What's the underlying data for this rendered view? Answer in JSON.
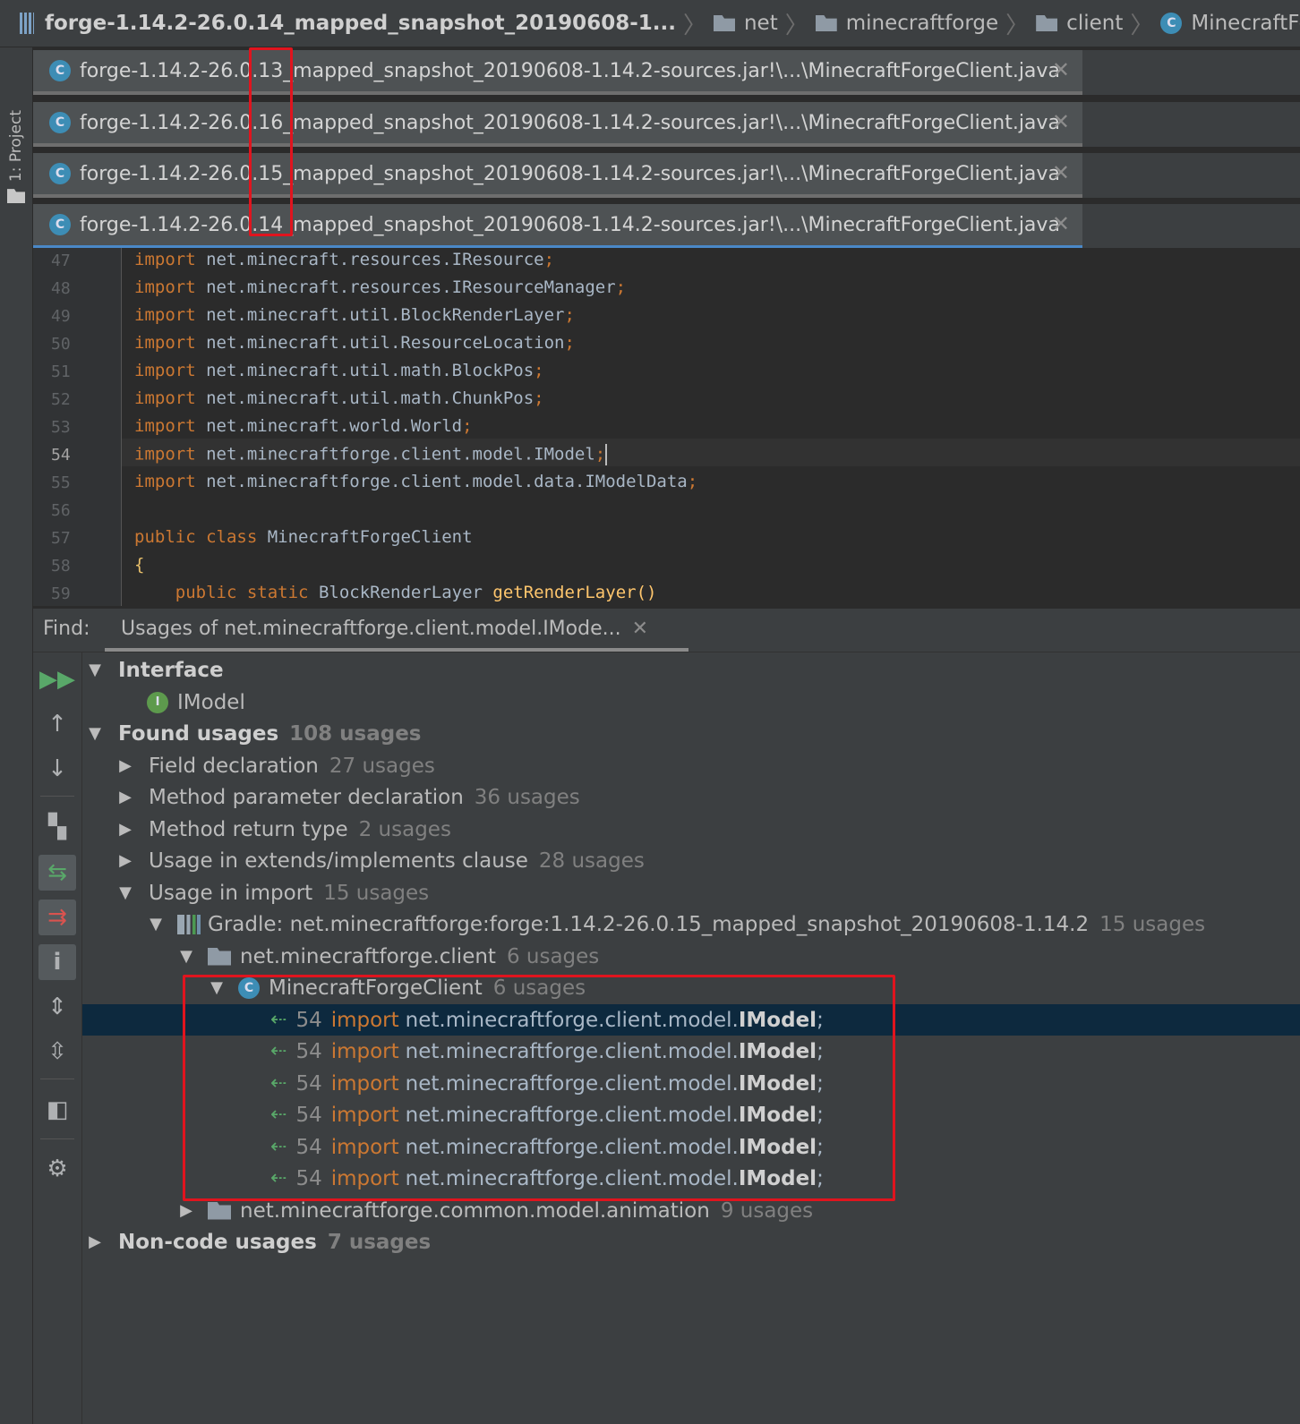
{
  "navbar": {
    "crumbs": [
      {
        "label": "forge-1.14.2-26.0.14_mapped_snapshot_20190608-1...",
        "icon": "jar-icon"
      },
      {
        "label": "net",
        "icon": "folder-icon"
      },
      {
        "label": "minecraftforge",
        "icon": "folder-icon"
      },
      {
        "label": "client",
        "icon": "folder-icon"
      },
      {
        "label": "MinecraftForgeClient",
        "icon": "class-icon"
      }
    ]
  },
  "left_strip": {
    "project_tab": "1: Project"
  },
  "editor_tabs": [
    {
      "title": "forge-1.14.2-26.0.13_mapped_snapshot_20190608-1.14.2-sources.jar!\\...\\MinecraftForgeClient.java",
      "active": false
    },
    {
      "title": "forge-1.14.2-26.0.16_mapped_snapshot_20190608-1.14.2-sources.jar!\\...\\MinecraftForgeClient.java",
      "active": false
    },
    {
      "title": "forge-1.14.2-26.0.15_mapped_snapshot_20190608-1.14.2-sources.jar!\\...\\MinecraftForgeClient.java",
      "active": false
    },
    {
      "title": "forge-1.14.2-26.0.14_mapped_snapshot_20190608-1.14.2-sources.jar!\\...\\MinecraftForgeClient.java",
      "active": true
    }
  ],
  "code": {
    "current_line": "54",
    "lines": [
      {
        "num": "47",
        "kw": "import",
        "rest": "net.minecraft.resources.IResource",
        "semi": ";"
      },
      {
        "num": "48",
        "kw": "import",
        "rest": "net.minecraft.resources.IResourceManager",
        "semi": ";"
      },
      {
        "num": "49",
        "kw": "import",
        "rest": "net.minecraft.util.BlockRenderLayer",
        "semi": ";"
      },
      {
        "num": "50",
        "kw": "import",
        "rest": "net.minecraft.util.ResourceLocation",
        "semi": ";"
      },
      {
        "num": "51",
        "kw": "import",
        "rest": "net.minecraft.util.math.BlockPos",
        "semi": ";"
      },
      {
        "num": "52",
        "kw": "import",
        "rest": "net.minecraft.util.math.ChunkPos",
        "semi": ";"
      },
      {
        "num": "53",
        "kw": "import",
        "rest": "net.minecraft.world.World",
        "semi": ";"
      },
      {
        "num": "54",
        "kw": "import",
        "rest": "net.minecraftforge.client.model.IModel",
        "semi": ";"
      },
      {
        "num": "55",
        "kw": "import",
        "rest": "net.minecraftforge.client.model.data.IModelData",
        "semi": ";"
      },
      {
        "num": "56",
        "kw": "",
        "rest": "",
        "semi": ""
      },
      {
        "num": "57",
        "kw": "public class",
        "rest": "MinecraftForgeClient",
        "semi": ""
      },
      {
        "num": "58",
        "kw": "",
        "rest": "{",
        "semi": ""
      },
      {
        "num": "59",
        "kw": "public static",
        "rest": "BlockRenderLayer",
        "fn": "getRenderLayer()",
        "semi": ""
      }
    ]
  },
  "find": {
    "label": "Find:",
    "tab_title": "Usages of net.minecraftforge.client.model.IMode...",
    "toolbar_icons": [
      "rerun-icon",
      "previous-occurrence-icon",
      "next-occurrence-icon",
      "group-by-icon",
      "show-read-access-icon",
      "show-write-access-icon",
      "info-icon",
      "expand-all-icon",
      "collapse-all-icon",
      "preview-icon",
      "settings-icon"
    ],
    "tree": {
      "interface_label": "Interface",
      "interface_name": "IModel",
      "found_label": "Found usages",
      "found_count": "108 usages",
      "groups": [
        {
          "label": "Field declaration",
          "count": "27 usages"
        },
        {
          "label": "Method parameter declaration",
          "count": "36 usages"
        },
        {
          "label": "Method return type",
          "count": "2 usages"
        },
        {
          "label": "Usage in extends/implements clause",
          "count": "28 usages"
        },
        {
          "label": "Usage in import",
          "count": "15 usages"
        }
      ],
      "gradle_label": "Gradle: net.minecraftforge:forge:1.14.2-26.0.15_mapped_snapshot_20190608-1.14.2",
      "gradle_count": "15 usages",
      "pkg_client_label": "net.minecraftforge.client",
      "pkg_client_count": "6 usages",
      "class_label": "MinecraftForgeClient",
      "class_count": "6 usages",
      "usage_line": {
        "num": "54",
        "kw": "import",
        "path": "net.minecraftforge.client.model.",
        "hit": "IModel",
        "semi": ";"
      },
      "pkg_anim_label": "net.minecraftforge.common.model.animation",
      "pkg_anim_count": "9 usages",
      "noncode_label": "Non-code usages",
      "noncode_count": "7 usages"
    }
  },
  "colors": {
    "background": "#2b2b2b",
    "panel": "#3c3f41",
    "keyword": "#cc7832",
    "identifier": "#a9b7c6",
    "selection": "#0d293e",
    "annotation_red": "#e0141e",
    "active_tab_underline": "#4a88c7"
  }
}
